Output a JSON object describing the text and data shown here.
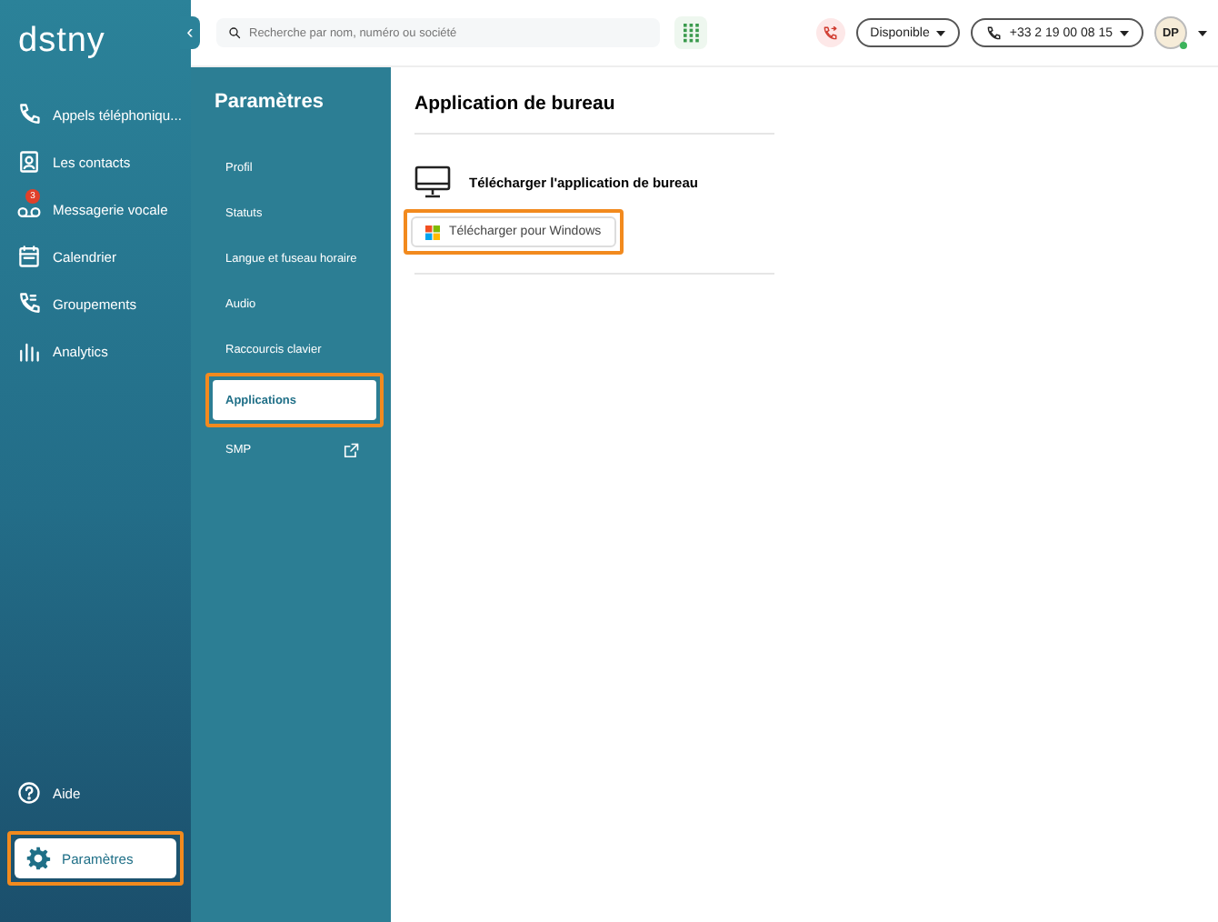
{
  "sidebar": {
    "logo": "dstny",
    "collapse_icon": "‹",
    "items": [
      {
        "label": "Appels téléphoniqu...",
        "kind": "phone",
        "selected": false
      },
      {
        "label": "Les contacts",
        "kind": "contacts",
        "selected": false
      },
      {
        "label": "Messagerie vocale",
        "kind": "voicemail",
        "selected": false,
        "badge": "3"
      },
      {
        "label": "Calendrier",
        "kind": "calendar",
        "selected": false
      },
      {
        "label": "Groupements",
        "kind": "group",
        "selected": false
      },
      {
        "label": "Analytics",
        "kind": "chart",
        "selected": false
      }
    ],
    "bottom_items": [
      {
        "label": "Aide",
        "kind": "help",
        "selected": false,
        "highlighted": false
      },
      {
        "label": "Paramètres",
        "kind": "gear",
        "selected": true,
        "highlighted": true
      }
    ]
  },
  "header": {
    "search": {
      "placeholder": "Recherche par nom, numéro ou société"
    },
    "status": "Disponible",
    "phone_number": "+33 2 19 00 08 15",
    "avatar": "DP",
    "online": true
  },
  "settings": {
    "title": "Paramètres",
    "items": [
      {
        "label": "Profil",
        "selected": false,
        "highlighted": false
      },
      {
        "label": "Statuts",
        "selected": false,
        "highlighted": false
      },
      {
        "label": "Langue et fuseau horaire",
        "selected": false,
        "highlighted": false
      },
      {
        "label": "Audio",
        "selected": false,
        "highlighted": false
      },
      {
        "label": "Raccourcis clavier",
        "selected": false,
        "highlighted": false
      },
      {
        "label": "Applications",
        "selected": true,
        "highlighted": true
      },
      {
        "label": "SMP",
        "selected": false,
        "highlighted": false,
        "external": true
      }
    ]
  },
  "content": {
    "title": "Application de bureau",
    "section_title": "Télécharger l'application de bureau",
    "download_button": {
      "label": "Télécharger pour Windows",
      "highlighted": true
    }
  }
}
